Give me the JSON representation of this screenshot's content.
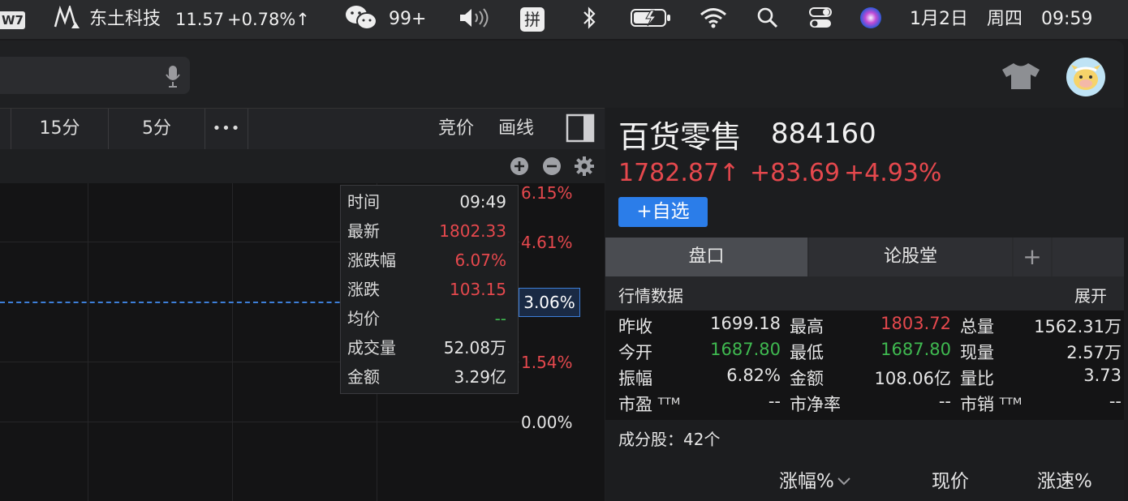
{
  "menubar": {
    "app_badge": "W7",
    "stock_name": "东土科技",
    "stock_price": "11.57",
    "stock_change": "+0.78%↑",
    "wechat_count": "99+",
    "input_method": "拼",
    "date": "1月2日",
    "weekday": "周四",
    "time": "09:59"
  },
  "toolbar": {
    "tabs": [
      "15分",
      "5分"
    ],
    "more": "•••",
    "bid_label": "竞价",
    "draw_label": "画线"
  },
  "chart": {
    "pct_labels": [
      "6.15%",
      "4.61%",
      "3.06%",
      "1.54%",
      "0.00%"
    ],
    "tooltip": {
      "rows": [
        {
          "label": "时间",
          "value": "09:49"
        },
        {
          "label": "最新",
          "value": "1802.33"
        },
        {
          "label": "涨跌幅",
          "value": "6.07%"
        },
        {
          "label": "涨跌",
          "value": "103.15"
        },
        {
          "label": "均价",
          "value": "--"
        },
        {
          "label": "成交量",
          "value": "52.08万"
        },
        {
          "label": "金额",
          "value": "3.29亿"
        }
      ]
    }
  },
  "stock": {
    "name": "百货零售",
    "code": "884160",
    "price": "1782.87↑",
    "change": "+83.69",
    "change_pct": "+4.93%",
    "watch_button": "+自选"
  },
  "tabs": {
    "pankou": "盘口",
    "forum": "论股堂",
    "add": "+"
  },
  "quote": {
    "section_title": "行情数据",
    "expand": "展开",
    "rows": [
      [
        {
          "label": "昨收",
          "value": "1699.18"
        },
        {
          "label": "最高",
          "value": "1803.72"
        },
        {
          "label": "总量",
          "value": "1562.31万"
        }
      ],
      [
        {
          "label": "今开",
          "value": "1687.80"
        },
        {
          "label": "最低",
          "value": "1687.80"
        },
        {
          "label": "现量",
          "value": "2.57万"
        }
      ],
      [
        {
          "label": "振幅",
          "value": "6.82%"
        },
        {
          "label": "金额",
          "value": "108.06亿"
        },
        {
          "label": "量比",
          "value": "3.73"
        }
      ],
      [
        {
          "label": "市盈 ᵀᵀᴹ",
          "value": "--"
        },
        {
          "label": "市净率",
          "value": "--"
        },
        {
          "label": "市销 ᵀᵀᴹ",
          "value": "--"
        }
      ]
    ],
    "components": "成分股：42个"
  },
  "list_header": {
    "change": "涨幅%",
    "price": "现价",
    "speed": "涨速%"
  },
  "colors": {
    "up": "#e5484d",
    "down": "#3fb950",
    "accent": "#2b7de9"
  }
}
